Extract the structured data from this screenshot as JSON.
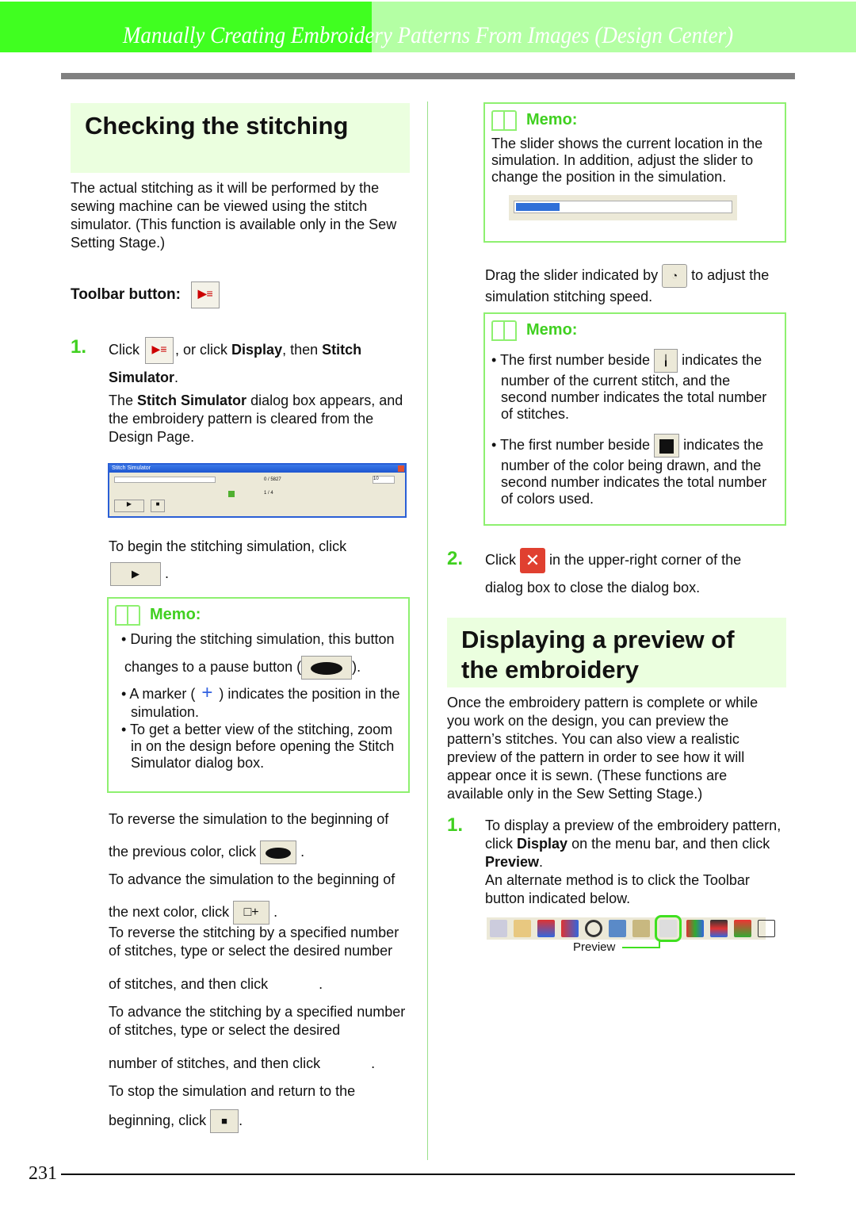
{
  "header": {
    "title": "Manually Creating Embroidery Patterns From Images (Design Center)",
    "colors": {
      "dark": "#40ff20",
      "light": "#b4ffa4"
    }
  },
  "left": {
    "section_title": "Checking the stitching",
    "intro": "The actual stitching as it will be performed by the sewing machine can be viewed using the stitch simulator. (This function is available only in the Sew Setting Stage.)",
    "toolbar_label": "Toolbar button:",
    "step1": {
      "num": "1.",
      "click": "Click",
      "mid": ", or click",
      "display": "Display",
      "then": ", then",
      "stitch": "Stitch",
      "simulator": "Simulator",
      "period": ".",
      "para_a": "The",
      "para_b": "Stitch Simulator",
      "para_c": "dialog box appears, and the embroidery pattern is cleared from the Design Page."
    },
    "dialog": {
      "title": "Stitch Simulator",
      "stitch_count": "0 / 5827",
      "color_count": "1 / 4",
      "step_value": "10"
    },
    "begin_text": "To begin the stitching simulation, click",
    "memo1": {
      "title": "Memo:",
      "b1a": "During the stitching simulation, this button",
      "b1b": "changes to a pause button (",
      "b1c": ").",
      "b2a": "A marker (",
      "b2b": ") indicates the position in the simulation.",
      "b3": "To get a better view of the stitching, zoom in on the design before opening the Stitch Simulator dialog box."
    },
    "reverse_color": "To reverse the simulation to the beginning of the previous color, click",
    "advance_color": "To advance the simulation to the beginning of the next color, click",
    "reverse_stitch_a": "To reverse the stitching by a specified number of stitches, type or select the desired number",
    "reverse_stitch_b": "of stitches, and then click",
    "advance_stitch_a": "To advance the stitching by a specified number of stitches, type or select the desired",
    "advance_stitch_b": "number of stitches, and then click",
    "stop_a": "To stop the simulation and return to the",
    "stop_b": "beginning, click"
  },
  "right": {
    "memo2": {
      "title": "Memo:",
      "text": "The slider shows the current location in the simulation. In addition, adjust the slider to change the position in the simulation.",
      "slider_position": 0.2
    },
    "drag_a": "Drag the slider indicated by",
    "drag_b": "to adjust the",
    "drag_c": "simulation stitching speed.",
    "memo3": {
      "title": "Memo:",
      "b1a": "The first number beside",
      "b1b": "indicates the",
      "b1c": "number of the current stitch, and the second number indicates the total number of stitches.",
      "b2a": "The first number beside",
      "b2b": "indicates the",
      "b2c": "number of the color being drawn, and the second number indicates the total number of colors used."
    },
    "step2": {
      "num": "2.",
      "a": "Click",
      "b": "in the upper-right corner of the",
      "c": "dialog box to close the dialog box."
    },
    "section2_title": "Displaying a preview of the embroidery",
    "section2_intro": "Once the embroidery pattern is complete or while you work on the design, you can preview the pattern’s stitches. You can also view a realistic preview of the pattern in order to see how it will appear once it is sewn. (These functions are available only in the Sew Setting Stage.)",
    "step1": {
      "num": "1.",
      "a": "To display a preview of the embroidery pattern, click",
      "display": "Display",
      "b": "on the menu bar, and then click",
      "preview": "Preview",
      "c": ".",
      "d": "An alternate method is to click the Toolbar button indicated below."
    },
    "toolbar_callout": "Preview"
  },
  "footer": {
    "page_number": "231"
  }
}
